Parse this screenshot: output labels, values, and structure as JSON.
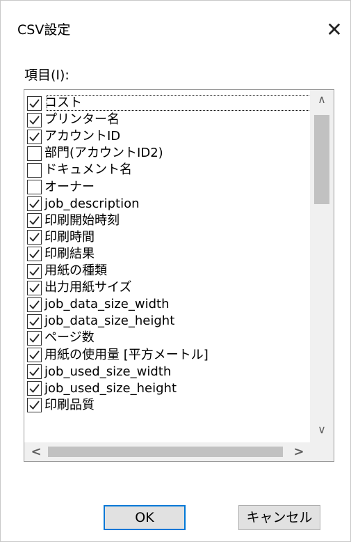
{
  "dialog": {
    "title": "CSV設定",
    "close_glyph": "✕"
  },
  "list": {
    "label": "項目(I):",
    "items": [
      {
        "label": "コスト",
        "checked": true
      },
      {
        "label": "プリンター名",
        "checked": true
      },
      {
        "label": "アカウントID",
        "checked": true
      },
      {
        "label": "部門(アカウントID2)",
        "checked": false
      },
      {
        "label": "ドキュメント名",
        "checked": false
      },
      {
        "label": "オーナー",
        "checked": false
      },
      {
        "label": "job_description",
        "checked": true
      },
      {
        "label": "印刷開始時刻",
        "checked": true
      },
      {
        "label": "印刷時間",
        "checked": true
      },
      {
        "label": "印刷結果",
        "checked": true
      },
      {
        "label": "用紙の種類",
        "checked": true
      },
      {
        "label": "出力用紙サイズ",
        "checked": true
      },
      {
        "label": "job_data_size_width",
        "checked": true
      },
      {
        "label": "job_data_size_height",
        "checked": true
      },
      {
        "label": "ページ数",
        "checked": true
      },
      {
        "label": "用紙の使用量 [平方メートル]",
        "checked": true
      },
      {
        "label": "job_used_size_width",
        "checked": true
      },
      {
        "label": "job_used_size_height",
        "checked": true
      },
      {
        "label": "印刷品質",
        "checked": true
      }
    ],
    "scroll_up_glyph": "∧",
    "scroll_down_glyph": "∨",
    "scroll_left_glyph": "<",
    "scroll_right_glyph": ">"
  },
  "buttons": {
    "ok": "OK",
    "cancel": "キャンセル"
  },
  "colors": {
    "default_button_border": "#0078d7",
    "scrollbar_track": "#f0f0f0",
    "scrollbar_thumb": "#c1c1c1"
  }
}
